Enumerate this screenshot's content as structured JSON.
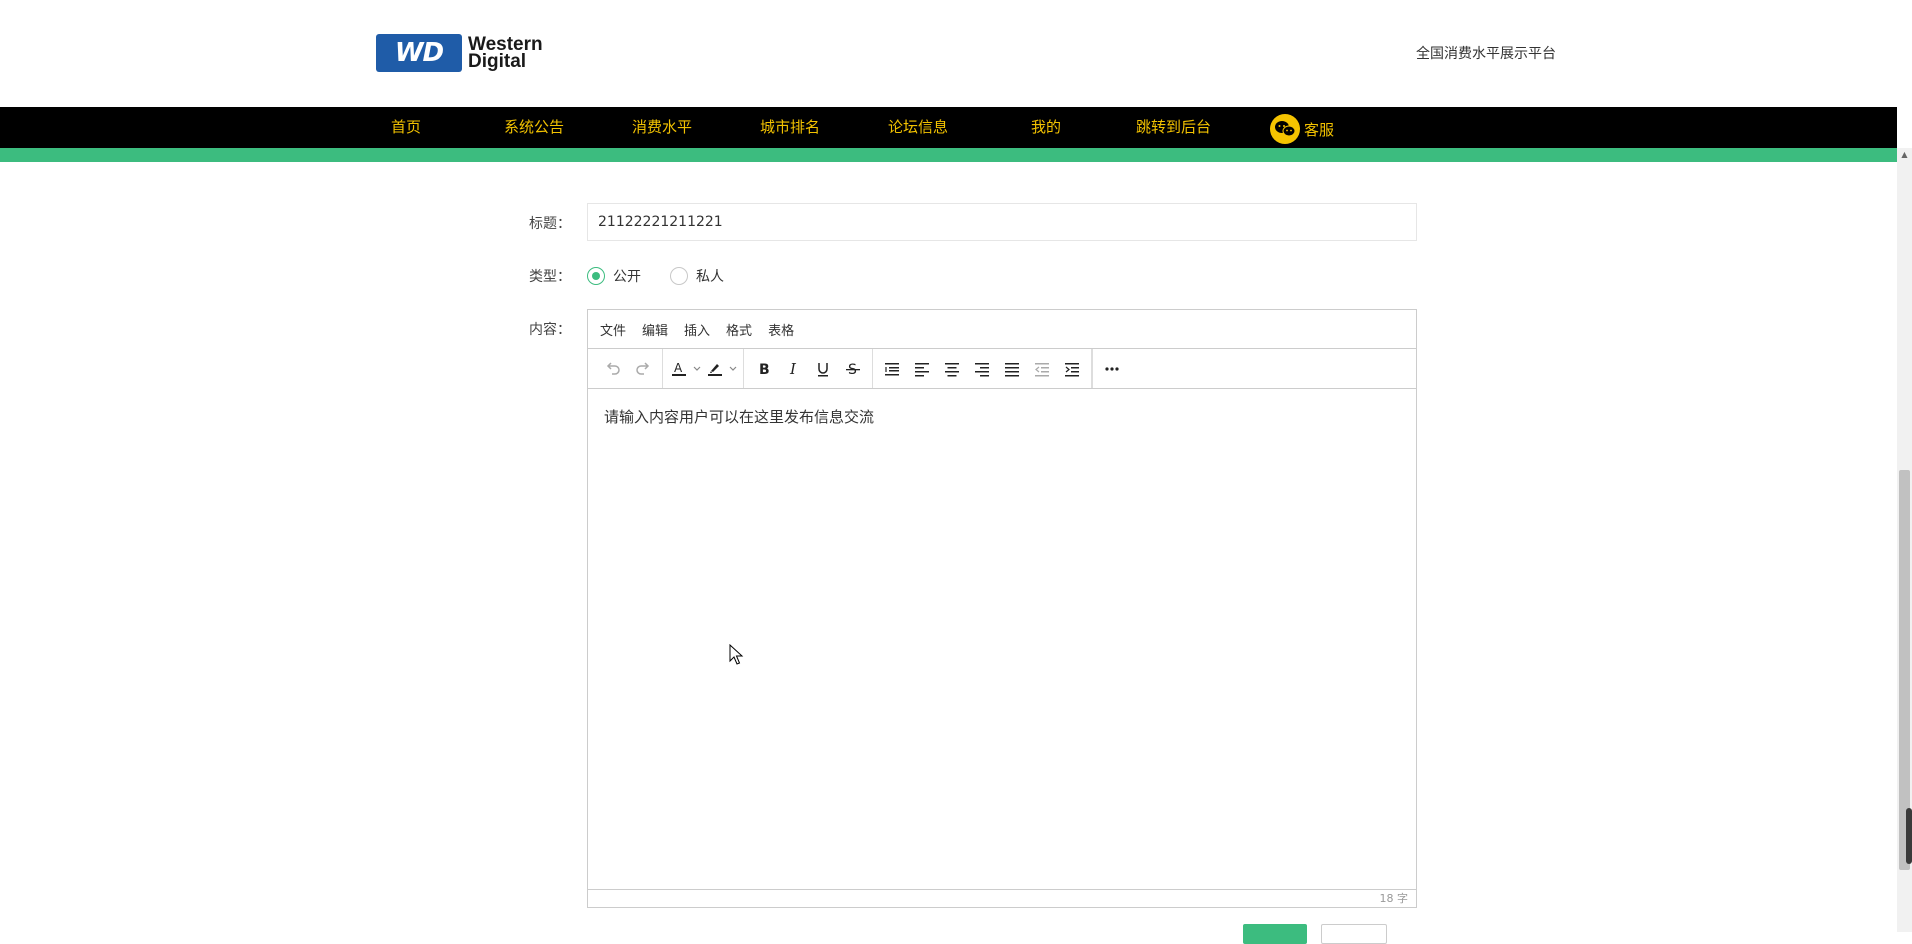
{
  "header": {
    "logo_mark": "WD",
    "logo_line1": "Western",
    "logo_line2": "Digital",
    "site_tagline": "全国消费水平展示平台"
  },
  "nav": {
    "items": [
      {
        "label": "首页"
      },
      {
        "label": "系统公告"
      },
      {
        "label": "消费水平"
      },
      {
        "label": "城市排名"
      },
      {
        "label": "论坛信息"
      },
      {
        "label": "我的"
      },
      {
        "label": "跳转到后台"
      }
    ],
    "service_label": "客服"
  },
  "form": {
    "title_label": "标题：",
    "title_value": "21122221211221",
    "type_label": "类型：",
    "type_options": [
      {
        "label": "公开",
        "checked": true
      },
      {
        "label": "私人",
        "checked": false
      }
    ],
    "content_label": "内容："
  },
  "editor": {
    "menus": [
      "文件",
      "编辑",
      "插入",
      "格式",
      "表格"
    ],
    "toolbar_icons": [
      "undo-icon",
      "redo-icon",
      "text-color-icon",
      "highlight-color-icon",
      "bold-icon",
      "italic-icon",
      "underline-icon",
      "strikethrough-icon",
      "line-height-icon",
      "align-left-icon",
      "align-center-icon",
      "align-right-icon",
      "align-justify-icon",
      "outdent-icon",
      "indent-icon",
      "more-icon"
    ],
    "body_text": "请输入内容用户可以在这里发布信息交流",
    "word_count": "18 字"
  },
  "colors": {
    "accent_green": "#3cbc7f",
    "nav_bg": "#000000",
    "nav_text": "#f2c200"
  }
}
